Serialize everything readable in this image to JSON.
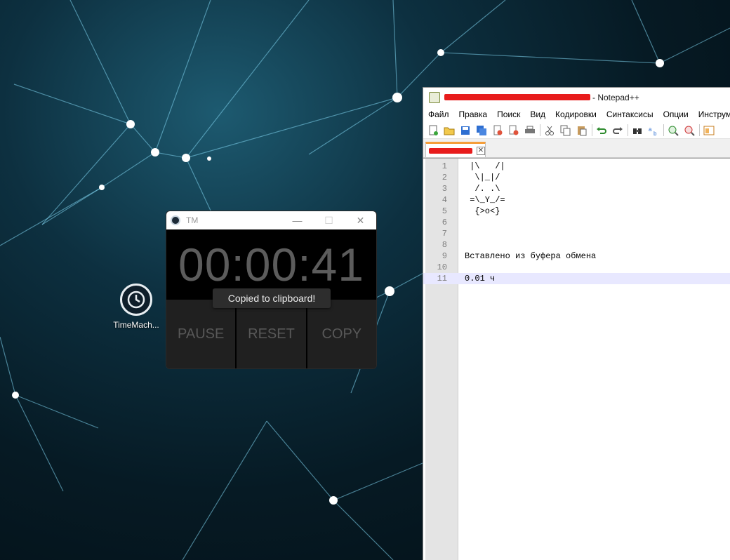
{
  "desktop": {
    "icon_label": "TimeMach...",
    "icon_name": "time-machine-icon"
  },
  "tm_window": {
    "title": "TM",
    "controls": {
      "minimize": "—",
      "maximize": "☐",
      "close": "✕"
    },
    "time": "00:00:41",
    "toast": "Copied to clipboard!",
    "buttons": {
      "pause": "PAUSE",
      "reset": "RESET",
      "copy": "COPY"
    },
    "colors": {
      "background": "#000000",
      "button": "#202020",
      "time_text": "#5c5c5c"
    }
  },
  "notepad": {
    "title_suffix": "- Notepad++",
    "menu": [
      "Файл",
      "Правка",
      "Поиск",
      "Вид",
      "Кодировки",
      "Синтаксисы",
      "Опции",
      "Инструм"
    ],
    "toolbar_icons": [
      "new-file-icon",
      "open-file-icon",
      "save-icon",
      "save-all-icon",
      "close-icon",
      "close-all-icon",
      "print-icon",
      "cut-icon",
      "copy-icon",
      "paste-icon",
      "undo-icon",
      "redo-icon",
      "find-icon",
      "replace-icon",
      "zoom-in-icon",
      "zoom-out-icon",
      "sync-view-icon"
    ],
    "tab_close": "✕",
    "lines": [
      {
        "num": "1",
        "text": " |\\   /|"
      },
      {
        "num": "2",
        "text": "  \\|_|/"
      },
      {
        "num": "3",
        "text": "  /. .\\"
      },
      {
        "num": "4",
        "text": " =\\_Y_/="
      },
      {
        "num": "5",
        "text": "  {>o<}"
      },
      {
        "num": "6",
        "text": ""
      },
      {
        "num": "7",
        "text": ""
      },
      {
        "num": "8",
        "text": ""
      },
      {
        "num": "9",
        "text": "Вставлено из буфера обмена"
      },
      {
        "num": "10",
        "text": ""
      },
      {
        "num": "11",
        "text": "0.01 ч"
      }
    ],
    "colors": {
      "current_line": "#e8e8ff",
      "tab_accent": "#f59e3a",
      "redaction": "#e81c1c"
    }
  }
}
